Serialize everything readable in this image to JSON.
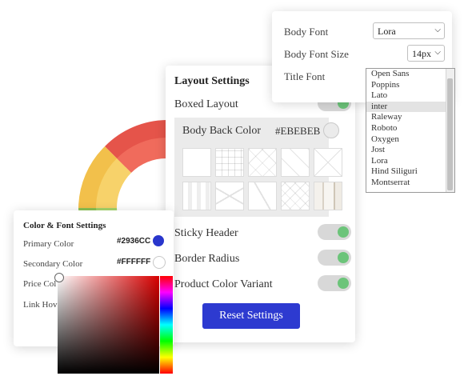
{
  "layout_settings": {
    "title": "Layout Settings",
    "boxed_layout_label": "Boxed Layout",
    "body_back_color_label": "Body Back Color",
    "body_back_color_value": "#EBEBEB",
    "sticky_header_label": "Sticky Header",
    "border_radius_label": "Border Radius",
    "product_color_variant_label": "Product Color Variant",
    "reset_button_label": "Reset Settings",
    "toggles": {
      "boxed_layout": true,
      "sticky_header": true,
      "border_radius": true,
      "product_color_variant": true
    }
  },
  "font_settings": {
    "body_font_label": "Body Font",
    "body_font_value": "Lora",
    "body_font_size_label": "Body Font Size",
    "body_font_size_value": "14px",
    "title_font_label": "Title Font",
    "title_font_options": [
      "Open Sans",
      "Poppins",
      "Lato",
      "inter",
      "Raleway",
      "Roboto",
      "Oxygen",
      "Jost",
      "Lora",
      "Hind Siliguri",
      "Montserrat"
    ],
    "title_font_selected": "inter"
  },
  "color_font_settings": {
    "title": "Color & Font Settings",
    "primary_color_label": "Primary Color",
    "primary_color_value": "#2936CC",
    "secondary_color_label": "Secondary Color",
    "secondary_color_value": "#FFFFFF",
    "price_color_label": "Price Col",
    "link_hover_label": "Link Hov"
  },
  "colors": {
    "accent": "#2D3AD0",
    "toggle_on": "#6CC47A",
    "primary_swatch": "#2936CC"
  }
}
